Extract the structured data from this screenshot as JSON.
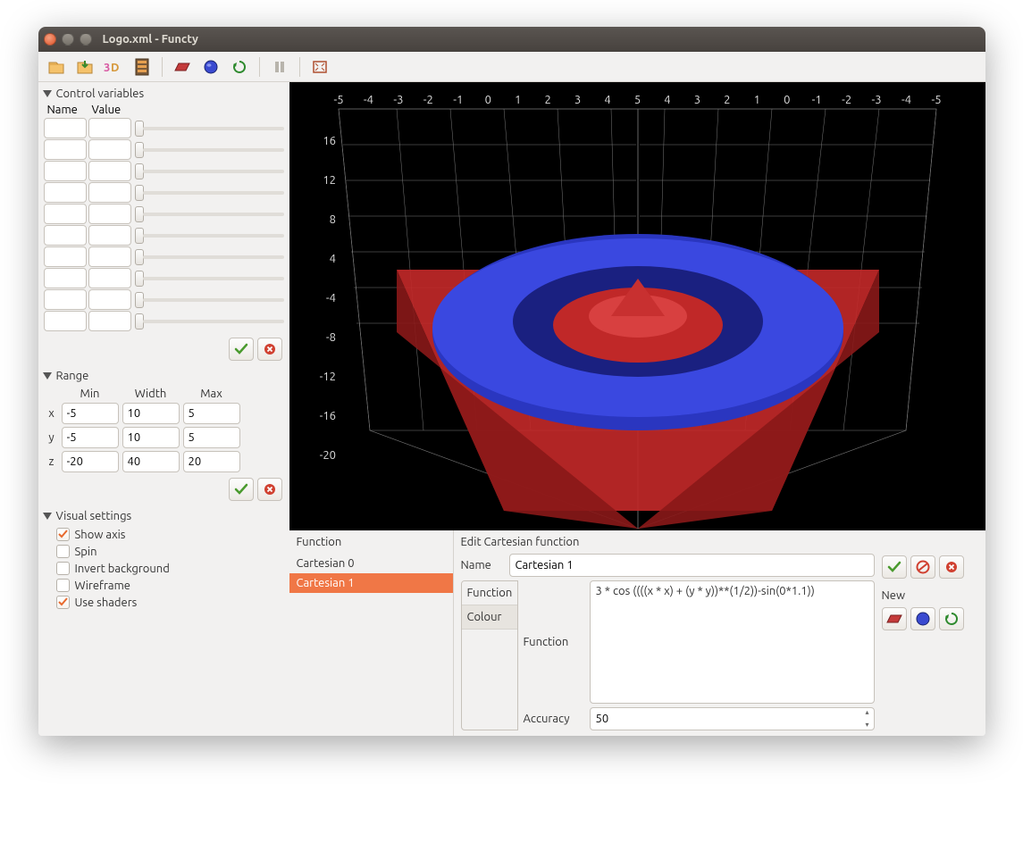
{
  "window": {
    "title": "Logo.xml - Functy"
  },
  "colors": {
    "close": "#e26033",
    "minimize": "#8c8780",
    "maximize": "#8c8780",
    "selection": "#f07746"
  },
  "toolbar_icons": [
    "open-icon",
    "save-icon",
    "export-3d-icon",
    "export-animation-icon",
    "plane-icon",
    "sphere-icon",
    "rotate-icon",
    "pause-icon",
    "fullscreen-icon"
  ],
  "sidebar": {
    "control_variables": {
      "title": "Control variables",
      "headers": {
        "name": "Name",
        "value": "Value"
      },
      "rows": [
        {
          "name": "",
          "value": ""
        },
        {
          "name": "",
          "value": ""
        },
        {
          "name": "",
          "value": ""
        },
        {
          "name": "",
          "value": ""
        },
        {
          "name": "",
          "value": ""
        },
        {
          "name": "",
          "value": ""
        },
        {
          "name": "",
          "value": ""
        },
        {
          "name": "",
          "value": ""
        },
        {
          "name": "",
          "value": ""
        },
        {
          "name": "",
          "value": ""
        }
      ]
    },
    "range": {
      "title": "Range",
      "headers": {
        "min": "Min",
        "width": "Width",
        "max": "Max"
      },
      "rows": {
        "x": {
          "label": "x",
          "min": "-5",
          "width": "10",
          "max": "5"
        },
        "y": {
          "label": "y",
          "min": "-5",
          "width": "10",
          "max": "5"
        },
        "z": {
          "label": "z",
          "min": "-20",
          "width": "40",
          "max": "20"
        }
      }
    },
    "visual": {
      "title": "Visual settings",
      "options": [
        {
          "label": "Show axis",
          "checked": true
        },
        {
          "label": "Spin",
          "checked": false
        },
        {
          "label": "Invert background",
          "checked": false
        },
        {
          "label": "Wireframe",
          "checked": false
        },
        {
          "label": "Use shaders",
          "checked": true
        }
      ]
    }
  },
  "viewport": {
    "x_ticks_top": [
      "-5",
      "-4",
      "-3",
      "-2",
      "-1",
      "0",
      "1",
      "2",
      "3",
      "4",
      "5",
      "4",
      "3",
      "2",
      "1",
      "0",
      "-1",
      "-2",
      "-3",
      "-4",
      "-5"
    ],
    "z_ticks_left": [
      "16",
      "12",
      "8",
      "4",
      "-4",
      "-8",
      "-12",
      "-16",
      "-20"
    ]
  },
  "functions": {
    "header": "Function",
    "items": [
      "Cartesian 0",
      "Cartesian 1"
    ],
    "selected_index": 1
  },
  "edit": {
    "title": "Edit Cartesian function",
    "name_label": "Name",
    "name_value": "Cartesian 1",
    "tabs": {
      "function": "Function",
      "colour": "Colour"
    },
    "function_label": "Function",
    "function_value": "3 * cos ((((x * x) + (y * y))**(1/2))-sin(0*1.1))",
    "accuracy_label": "Accuracy",
    "accuracy_value": "50",
    "new_label": "New"
  }
}
